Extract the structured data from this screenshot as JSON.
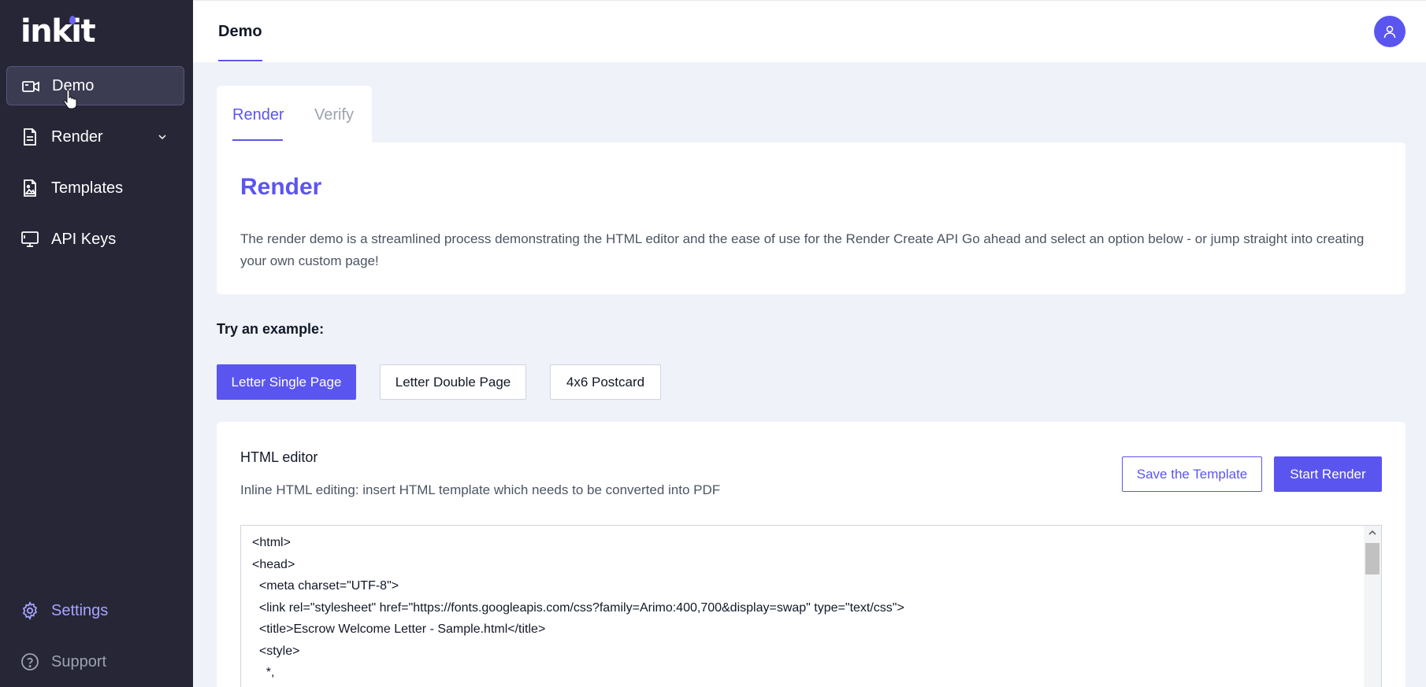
{
  "brand": {
    "name": "inkit"
  },
  "sidebar": {
    "items": [
      {
        "label": "Demo",
        "icon": "video-icon",
        "active": true
      },
      {
        "label": "Render",
        "icon": "document-icon",
        "has_submenu": true
      },
      {
        "label": "Templates",
        "icon": "image-file-icon"
      },
      {
        "label": "API Keys",
        "icon": "monitor-icon"
      }
    ],
    "settings_label": "Settings",
    "support_label": "Support"
  },
  "topbar": {
    "tab_label": "Demo"
  },
  "subtabs": {
    "render_label": "Render",
    "verify_label": "Verify"
  },
  "intro": {
    "title": "Render",
    "description": "The render demo is a streamlined process demonstrating the HTML editor and the ease of use for the Render Create API Go ahead and select an option below - or jump straight into creating your own custom page!"
  },
  "examples": {
    "label": "Try an example:",
    "options": [
      "Letter Single Page",
      "Letter Double Page",
      "4x6 Postcard"
    ]
  },
  "editor": {
    "title": "HTML editor",
    "subtitle": "Inline HTML editing: insert HTML template which needs to be converted into PDF",
    "save_label": "Save the Template",
    "start_label": "Start Render",
    "code_lines": [
      "<html>",
      "<head>",
      "  <meta charset=\"UTF-8\">",
      "  <link rel=\"stylesheet\" href=\"https://fonts.googleapis.com/css?family=Arimo:400,700&display=swap\" type=\"text/css\">",
      "  <title>Escrow Welcome Letter - Sample.html</title>",
      "  <style>",
      "    *,"
    ]
  },
  "colors": {
    "accent": "#5b55f0",
    "sidebar_bg": "#262637",
    "page_bg": "#eff2f8"
  }
}
